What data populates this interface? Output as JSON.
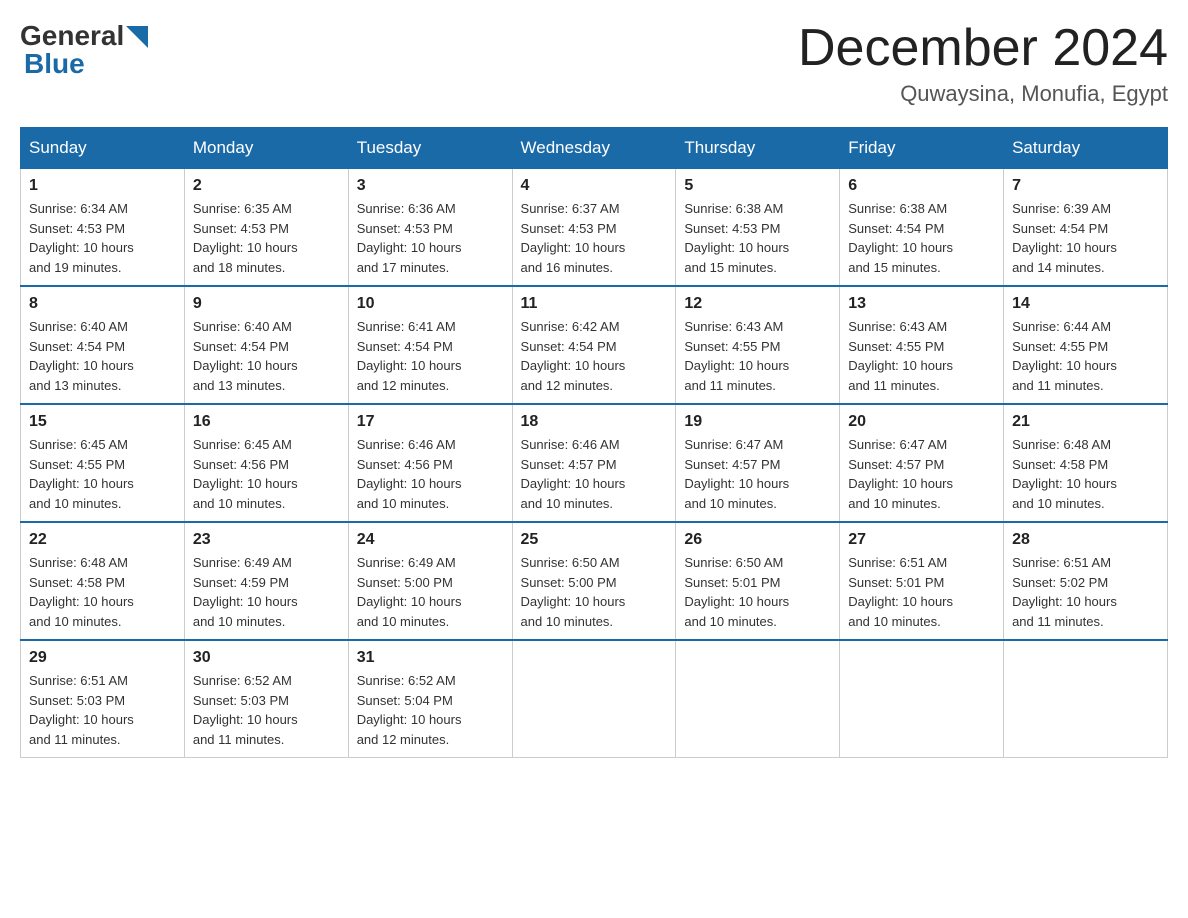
{
  "header": {
    "logo": {
      "general": "General",
      "blue": "Blue"
    },
    "title": "December 2024",
    "location": "Quwaysina, Monufia, Egypt"
  },
  "weekdays": [
    "Sunday",
    "Monday",
    "Tuesday",
    "Wednesday",
    "Thursday",
    "Friday",
    "Saturday"
  ],
  "weeks": [
    [
      {
        "day": "1",
        "sunrise": "6:34 AM",
        "sunset": "4:53 PM",
        "daylight": "10 hours and 19 minutes."
      },
      {
        "day": "2",
        "sunrise": "6:35 AM",
        "sunset": "4:53 PM",
        "daylight": "10 hours and 18 minutes."
      },
      {
        "day": "3",
        "sunrise": "6:36 AM",
        "sunset": "4:53 PM",
        "daylight": "10 hours and 17 minutes."
      },
      {
        "day": "4",
        "sunrise": "6:37 AM",
        "sunset": "4:53 PM",
        "daylight": "10 hours and 16 minutes."
      },
      {
        "day": "5",
        "sunrise": "6:38 AM",
        "sunset": "4:53 PM",
        "daylight": "10 hours and 15 minutes."
      },
      {
        "day": "6",
        "sunrise": "6:38 AM",
        "sunset": "4:54 PM",
        "daylight": "10 hours and 15 minutes."
      },
      {
        "day": "7",
        "sunrise": "6:39 AM",
        "sunset": "4:54 PM",
        "daylight": "10 hours and 14 minutes."
      }
    ],
    [
      {
        "day": "8",
        "sunrise": "6:40 AM",
        "sunset": "4:54 PM",
        "daylight": "10 hours and 13 minutes."
      },
      {
        "day": "9",
        "sunrise": "6:40 AM",
        "sunset": "4:54 PM",
        "daylight": "10 hours and 13 minutes."
      },
      {
        "day": "10",
        "sunrise": "6:41 AM",
        "sunset": "4:54 PM",
        "daylight": "10 hours and 12 minutes."
      },
      {
        "day": "11",
        "sunrise": "6:42 AM",
        "sunset": "4:54 PM",
        "daylight": "10 hours and 12 minutes."
      },
      {
        "day": "12",
        "sunrise": "6:43 AM",
        "sunset": "4:55 PM",
        "daylight": "10 hours and 11 minutes."
      },
      {
        "day": "13",
        "sunrise": "6:43 AM",
        "sunset": "4:55 PM",
        "daylight": "10 hours and 11 minutes."
      },
      {
        "day": "14",
        "sunrise": "6:44 AM",
        "sunset": "4:55 PM",
        "daylight": "10 hours and 11 minutes."
      }
    ],
    [
      {
        "day": "15",
        "sunrise": "6:45 AM",
        "sunset": "4:55 PM",
        "daylight": "10 hours and 10 minutes."
      },
      {
        "day": "16",
        "sunrise": "6:45 AM",
        "sunset": "4:56 PM",
        "daylight": "10 hours and 10 minutes."
      },
      {
        "day": "17",
        "sunrise": "6:46 AM",
        "sunset": "4:56 PM",
        "daylight": "10 hours and 10 minutes."
      },
      {
        "day": "18",
        "sunrise": "6:46 AM",
        "sunset": "4:57 PM",
        "daylight": "10 hours and 10 minutes."
      },
      {
        "day": "19",
        "sunrise": "6:47 AM",
        "sunset": "4:57 PM",
        "daylight": "10 hours and 10 minutes."
      },
      {
        "day": "20",
        "sunrise": "6:47 AM",
        "sunset": "4:57 PM",
        "daylight": "10 hours and 10 minutes."
      },
      {
        "day": "21",
        "sunrise": "6:48 AM",
        "sunset": "4:58 PM",
        "daylight": "10 hours and 10 minutes."
      }
    ],
    [
      {
        "day": "22",
        "sunrise": "6:48 AM",
        "sunset": "4:58 PM",
        "daylight": "10 hours and 10 minutes."
      },
      {
        "day": "23",
        "sunrise": "6:49 AM",
        "sunset": "4:59 PM",
        "daylight": "10 hours and 10 minutes."
      },
      {
        "day": "24",
        "sunrise": "6:49 AM",
        "sunset": "5:00 PM",
        "daylight": "10 hours and 10 minutes."
      },
      {
        "day": "25",
        "sunrise": "6:50 AM",
        "sunset": "5:00 PM",
        "daylight": "10 hours and 10 minutes."
      },
      {
        "day": "26",
        "sunrise": "6:50 AM",
        "sunset": "5:01 PM",
        "daylight": "10 hours and 10 minutes."
      },
      {
        "day": "27",
        "sunrise": "6:51 AM",
        "sunset": "5:01 PM",
        "daylight": "10 hours and 10 minutes."
      },
      {
        "day": "28",
        "sunrise": "6:51 AM",
        "sunset": "5:02 PM",
        "daylight": "10 hours and 11 minutes."
      }
    ],
    [
      {
        "day": "29",
        "sunrise": "6:51 AM",
        "sunset": "5:03 PM",
        "daylight": "10 hours and 11 minutes."
      },
      {
        "day": "30",
        "sunrise": "6:52 AM",
        "sunset": "5:03 PM",
        "daylight": "10 hours and 11 minutes."
      },
      {
        "day": "31",
        "sunrise": "6:52 AM",
        "sunset": "5:04 PM",
        "daylight": "10 hours and 12 minutes."
      },
      null,
      null,
      null,
      null
    ]
  ],
  "labels": {
    "sunrise": "Sunrise:",
    "sunset": "Sunset:",
    "daylight": "Daylight:"
  }
}
